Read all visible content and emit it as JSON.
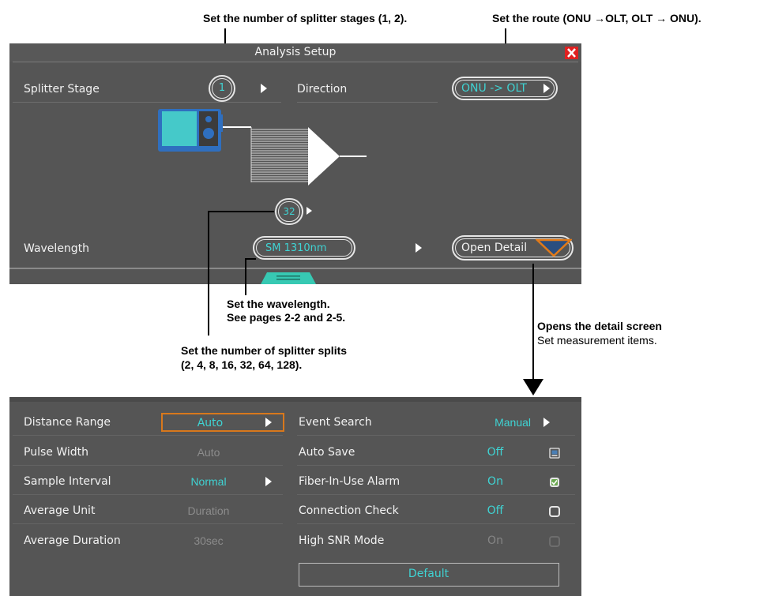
{
  "annotations": {
    "stages": "Set the number of splitter stages (1, 2).",
    "route": "Set the route (ONU →OLT, OLT → ONU).",
    "wavelength_1": "Set the wavelength.",
    "wavelength_2": "See pages 2-2 and 2-5.",
    "splits_1": "Set the number of splitter splits",
    "splits_2": "(2, 4, 8, 16, 32, 64, 128).",
    "detail_1": "Opens the detail screen",
    "detail_2": "Set measurement items."
  },
  "analysis_setup": {
    "title": "Analysis Setup",
    "splitter_stage_label": "Splitter Stage",
    "splitter_stage_value": "1",
    "direction_label": "Direction",
    "direction_value": "ONU -> OLT",
    "splits_value": "32",
    "wavelength_label": "Wavelength",
    "wavelength_value": "SM 1310nm",
    "open_detail_label": "Open Detail"
  },
  "detail": {
    "left_rows": [
      {
        "label": "Distance Range",
        "value": "Auto",
        "state": "selected"
      },
      {
        "label": "Pulse Width",
        "value": "Auto",
        "state": "disabled"
      },
      {
        "label": "Sample Interval",
        "value": "Normal",
        "state": "active"
      },
      {
        "label": "Average Unit",
        "value": "Duration",
        "state": "disabled"
      },
      {
        "label": "Average Duration",
        "value": "30sec",
        "state": "disabled"
      }
    ],
    "right_rows": [
      {
        "label": "Event Search",
        "value": "Manual",
        "control": "arrow",
        "state": "active"
      },
      {
        "label": "Auto Save",
        "value": "Off",
        "control": "settings",
        "state": "active"
      },
      {
        "label": "Fiber-In-Use Alarm",
        "value": "On",
        "control": "checked",
        "state": "active"
      },
      {
        "label": "Connection Check",
        "value": "Off",
        "control": "unchecked",
        "state": "active"
      },
      {
        "label": "High SNR Mode",
        "value": "On",
        "control": "disabled",
        "state": "disabled"
      }
    ],
    "default_label": "Default"
  },
  "colors": {
    "panel": "#555555",
    "teal": "#3fd3d3",
    "selected_border": "#d8781c",
    "close": "#e02020"
  }
}
